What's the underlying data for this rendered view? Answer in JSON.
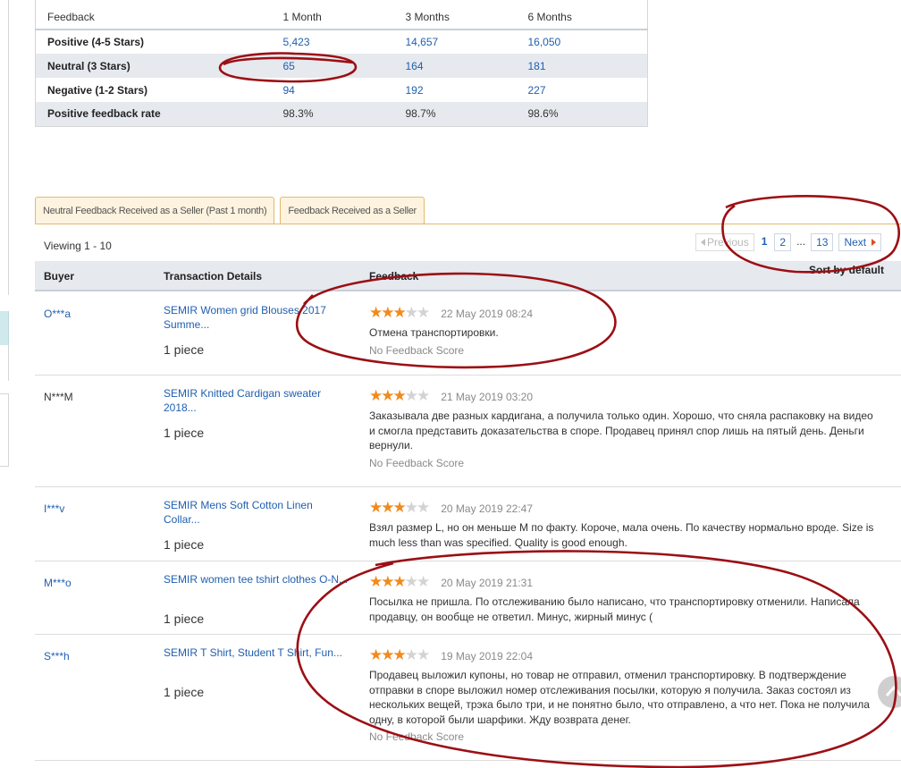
{
  "summary": {
    "headers": [
      "Feedback",
      "1 Month",
      "3 Months",
      "6 Months"
    ],
    "rows": [
      {
        "label": "Positive (4-5 Stars)",
        "m1": "5,423",
        "m3": "14,657",
        "m6": "16,050"
      },
      {
        "label": "Neutral (3 Stars)",
        "m1": "65",
        "m3": "164",
        "m6": "181"
      },
      {
        "label": "Negative (1-2 Stars)",
        "m1": "94",
        "m3": "192",
        "m6": "227"
      },
      {
        "label": "Positive feedback rate",
        "m1": "98.3%",
        "m3": "98.7%",
        "m6": "98.6%"
      }
    ]
  },
  "tabs": [
    {
      "label": "Neutral Feedback Received as a Seller (Past 1 month)"
    },
    {
      "label": "Feedback Received as a Seller"
    }
  ],
  "viewing": "Viewing 1 - 10",
  "pagination": {
    "previous": "Previous",
    "pages": [
      "1",
      "2"
    ],
    "dots": "...",
    "last": "13",
    "next": "Next",
    "current": "1"
  },
  "list": {
    "headers": {
      "buyer": "Buyer",
      "transaction": "Transaction Details",
      "feedback": "Feedback",
      "sort": "Sort by default"
    }
  },
  "feedback": [
    {
      "buyer": "O***a",
      "product": "SEMIR Women grid Blouses 2017 Summe...",
      "qty": "1 piece",
      "stars": 3,
      "date": "22 May 2019 08:24",
      "text": "Отмена транспортировки.",
      "score": "No Feedback Score"
    },
    {
      "buyer": "N***M",
      "product": "SEMIR Knitted Cardigan sweater 2018...",
      "qty": "1 piece",
      "stars": 3,
      "date": "21 May 2019 03:20",
      "text": "Заказывала две разных кардигана, а получила только один. Хорошо, что сняла распаковку на видео и смогла представить доказательства в споре. Продавец принял спор лишь на пятый день. Деньги вернули.",
      "score": "No Feedback Score"
    },
    {
      "buyer": "I***v",
      "product": "SEMIR Mens Soft Cotton Linen Collar...",
      "qty": "1 piece",
      "stars": 3,
      "date": "20 May 2019 22:47",
      "text": "Взял размер L, но он меньше М по факту. Короче, мала очень. По качеству нормально вроде. Size is much less than was specified. Quality is good enough.",
      "score": ""
    },
    {
      "buyer": "M***o",
      "product": "SEMIR women tee tshirt clothes O-N...",
      "qty": "1 piece",
      "stars": 3,
      "date": "20 May 2019 21:31",
      "text": "Посылка не пришла. По отслеживанию было написано, что транспортировку отменили. Написала продавцу, он вообще не ответил. Минус, жирный минус (",
      "score": ""
    },
    {
      "buyer": "S***h",
      "product": "SEMIR T Shirt, Student T Shirt, Fun...",
      "qty": "1 piece",
      "stars": 3,
      "date": "19 May 2019 22:04",
      "text": "Продавец выложил купоны, но товар не отправил, отменил транспортировку. В подтверждение отправки в споре выложил номер отслеживания посылки, которую я получила. Заказ состоял из нескольких вещей, трэка было три, и не понятно было, что отправлено, а что нет. Пока не получила одну, в которой были шарфики. Жду возврата денег.",
      "score": "No Feedback Score"
    }
  ],
  "colors": {
    "link": "#1f5fb0",
    "star": "#f28a1a",
    "annotation": "#9b0f14",
    "tab_border": "#e3b96d"
  }
}
